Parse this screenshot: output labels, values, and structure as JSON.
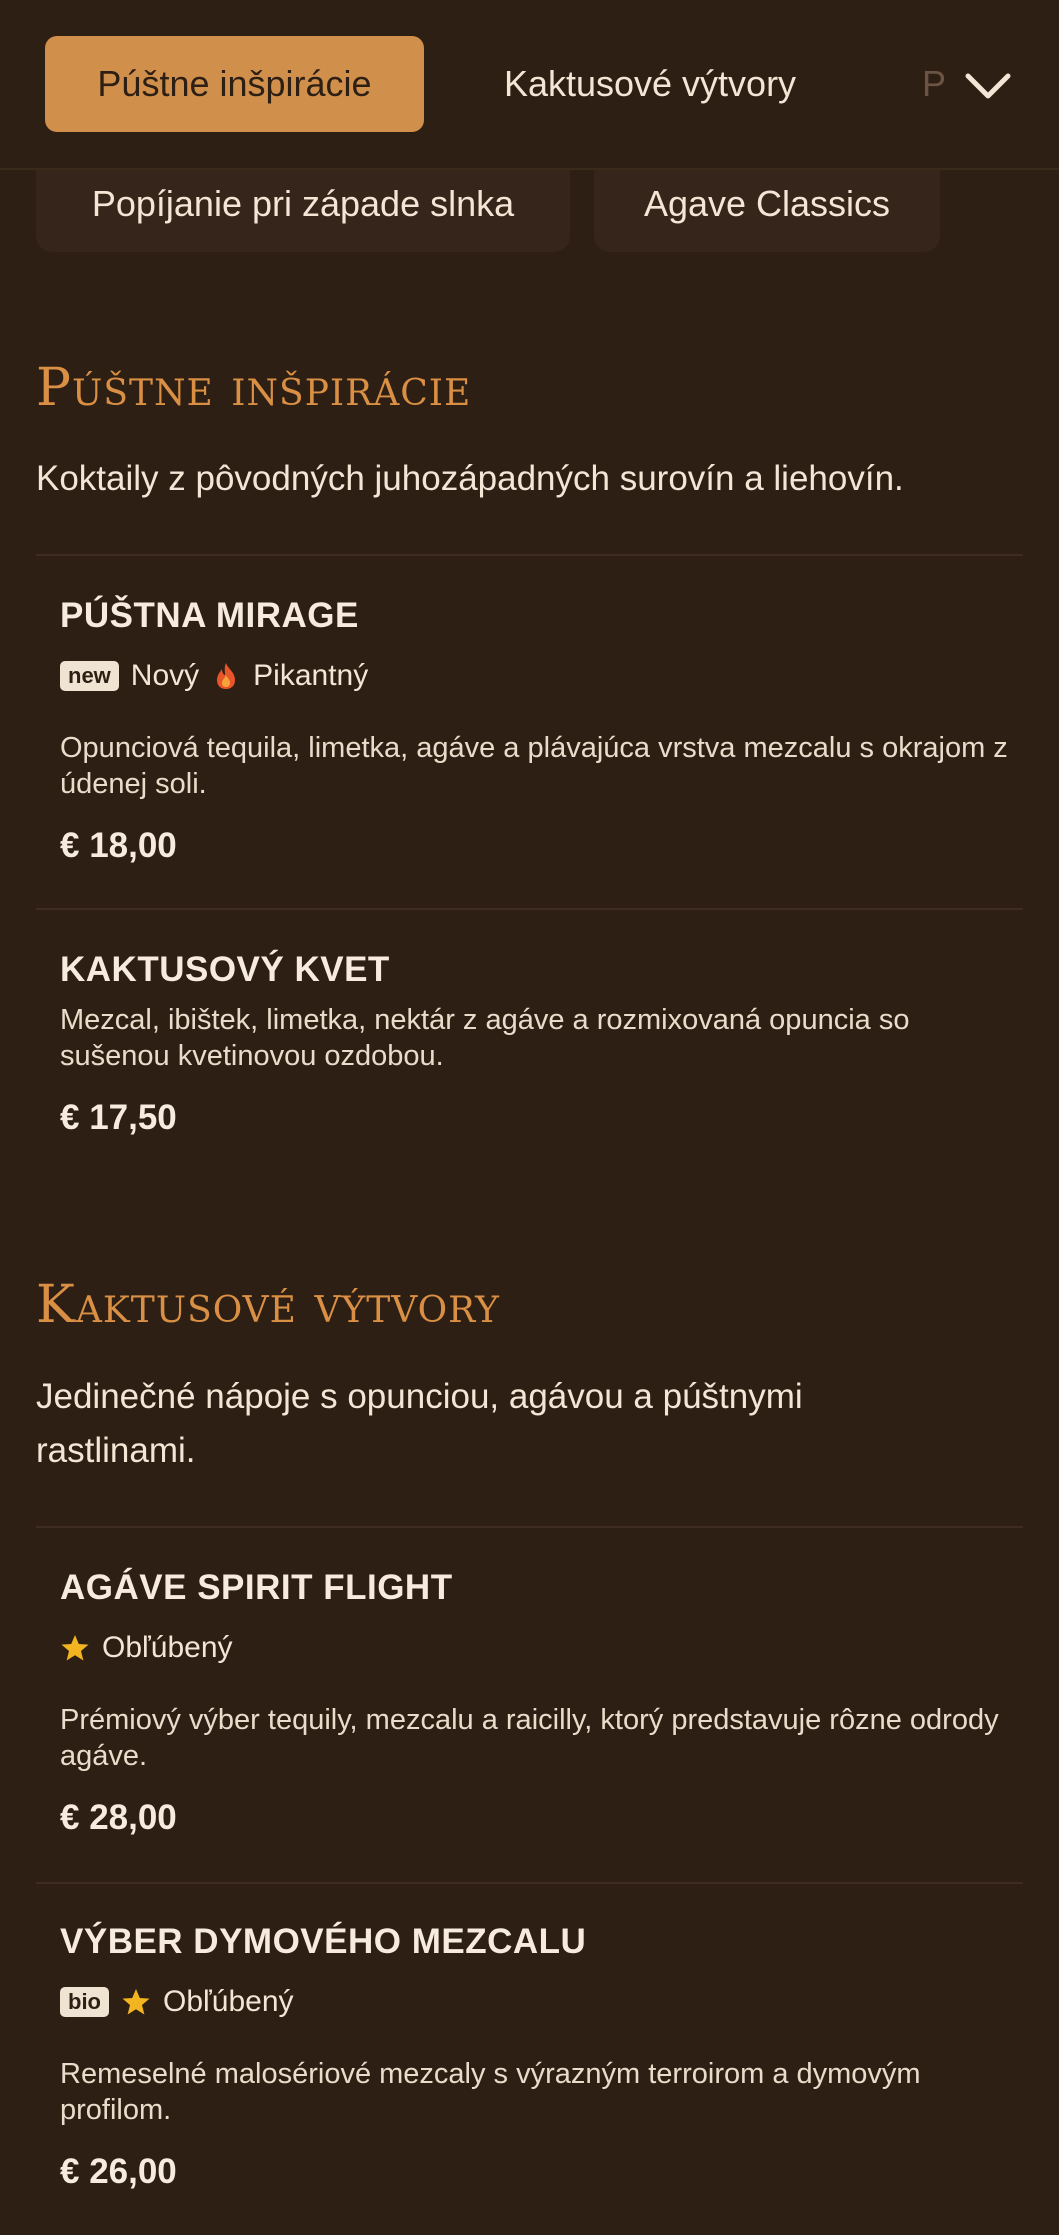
{
  "nav": {
    "tabs": [
      {
        "label": "Púštne inšpirácie",
        "active": true
      },
      {
        "label": "Kaktusové výtvory"
      },
      {
        "label": "P"
      }
    ],
    "chips": [
      "Popíjanie pri západe slnka",
      "Agave Classics"
    ],
    "expand_icon": "chevron-down-icon"
  },
  "colors": {
    "background": "#2e1f14",
    "accent": "#d0904c",
    "section_title": "#d98f44",
    "spicy": "#e8552a",
    "star": "#f2b51f"
  },
  "sections": [
    {
      "title": "Púštne inšpirácie",
      "description": "Koktaily z pôvodných juhozápadných surovín a liehovín.",
      "items": [
        {
          "name": "PÚŠTNA MIRAGE",
          "tag": "new",
          "badges": [
            "Nový",
            "Pikantný"
          ],
          "badge_icons": [
            "fire-icon"
          ],
          "description": "Opunciová tequila, limetka, agáve a plávajúca vrstva mezcalu s okrajom z údenej soli.",
          "price": "€ 18,00"
        },
        {
          "name": "KAKTUSOVÝ KVET",
          "description": "Mezcal, ibištek, limetka, nektár z agáve a rozmixovaná opuncia so sušenou kvetinovou ozdobou.",
          "price": "€ 17,50"
        }
      ]
    },
    {
      "title": "Kaktusové výtvory",
      "description": "Jedinečné nápoje s opunciou, agávou a púštnymi rastlinami.",
      "items": [
        {
          "name": "AGÁVE SPIRIT FLIGHT",
          "badges": [
            "Obľúbený"
          ],
          "badge_icons": [
            "star-icon"
          ],
          "description": "Prémiový výber tequily, mezcalu a raicilly, ktorý predstavuje rôzne odrody agáve.",
          "price": "€ 28,00"
        },
        {
          "name": "VÝBER DYMOVÉHO MEZCALU",
          "tag": "bio",
          "badges": [
            "Obľúbený"
          ],
          "badge_icons": [
            "star-icon"
          ],
          "description": "Remeselné malosériové mezcaly s výrazným terroirom a dymovým profilom.",
          "price": "€ 26,00"
        }
      ]
    }
  ]
}
